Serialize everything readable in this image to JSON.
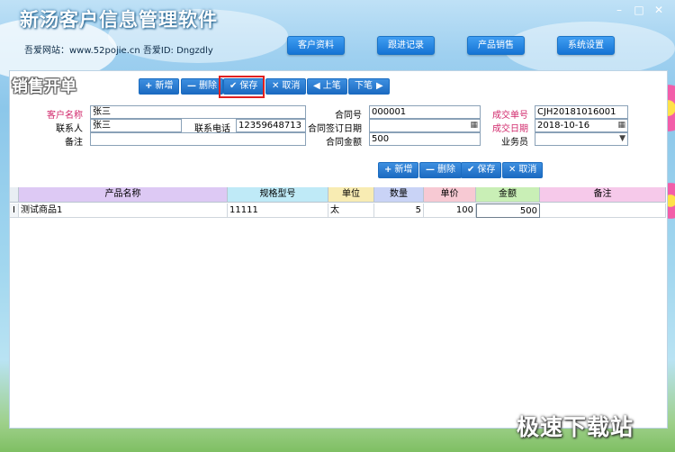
{
  "app": {
    "title": "新汤客户信息管理软件",
    "subtitle": "吾爱网站：www.52pojie.cn  吾爱ID: Dngzdly"
  },
  "nav": {
    "customer_info": "客户资料",
    "follow_up": "跟进记录",
    "product_sales": "产品销售",
    "system_settings": "系统设置"
  },
  "panel": {
    "title": "销售开单"
  },
  "toolbar": {
    "add": "新增",
    "delete": "删除",
    "save": "保存",
    "cancel": "取消",
    "prev": "上笔",
    "next": "下笔"
  },
  "form": {
    "customer_name_label": "客户名称",
    "customer_name_value": "张三",
    "contact_label": "联系人",
    "contact_value": "张三",
    "phone_label": "联系电话",
    "phone_value": "12359648713",
    "remark_label": "备注",
    "remark_value": "",
    "contract_no_label": "合同号",
    "contract_no_value": "000001",
    "sign_date_label": "合同签订日期",
    "sign_date_value": "",
    "amount_label": "合同金额",
    "amount_value": "500",
    "deal_no_label": "成交单号",
    "deal_no_value": "CJH20181016001",
    "deal_date_label": "成交日期",
    "deal_date_value": "2018-10-16",
    "salesman_label": "业务员",
    "salesman_value": ""
  },
  "detail_toolbar": {
    "add": "新增",
    "delete": "删除",
    "save": "保存",
    "cancel": "取消"
  },
  "grid": {
    "columns": [
      "产品名称",
      "规格型号",
      "单位",
      "数量",
      "单价",
      "金额",
      "备注"
    ],
    "rows": [
      {
        "indicator": "I",
        "name": "测试商品1",
        "spec": "11111",
        "unit": "太",
        "qty": "5",
        "price": "100",
        "amount": "500",
        "remark": ""
      }
    ]
  },
  "watermark": "极速下载站",
  "icons": {
    "add": "plus-icon",
    "delete": "minus-icon",
    "save": "check-icon",
    "cancel": "x-icon",
    "prev": "triangle-left-icon",
    "next": "triangle-right-icon",
    "calendar": "calendar-icon",
    "dropdown": "chevron-down-icon"
  }
}
